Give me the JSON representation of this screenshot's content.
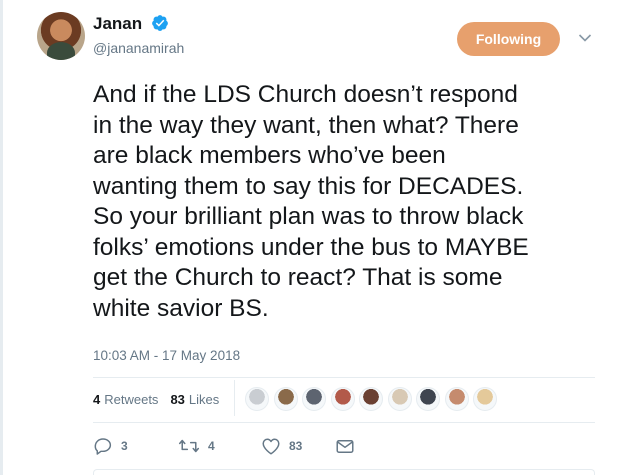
{
  "author": {
    "name": "Janan",
    "handle": "@jananamirah",
    "verified": true
  },
  "follow_button": {
    "label": "Following",
    "color": "#e7a06d"
  },
  "tweet": {
    "lines": [
      "And if the LDS Church doesn’t respond",
      "in the way they want, then what? There",
      "are black members who’ve been",
      "wanting them to say this for DECADES.",
      "So your brilliant plan was to throw black",
      "folks’ emotions under the bus to MAYBE",
      "get the Church to react? That is some",
      "white savior BS."
    ],
    "timestamp": "10:03 AM - 17 May 2018"
  },
  "stats": {
    "retweets_count": "4",
    "retweets_label": "Retweets",
    "likes_count": "83",
    "likes_label": "Likes"
  },
  "liker_avatars": [
    {
      "icon": "liker-avatar-1",
      "color": "#c9cdd2"
    },
    {
      "icon": "liker-avatar-2",
      "color": "#8a6a4a"
    },
    {
      "icon": "liker-avatar-3",
      "color": "#5d6470"
    },
    {
      "icon": "liker-avatar-4",
      "color": "#b25a4a"
    },
    {
      "icon": "liker-avatar-5",
      "color": "#6a4032"
    },
    {
      "icon": "liker-avatar-6",
      "color": "#d8c9b4"
    },
    {
      "icon": "liker-avatar-7",
      "color": "#3f4550"
    },
    {
      "icon": "liker-avatar-8",
      "color": "#c58b6e"
    },
    {
      "icon": "liker-avatar-9",
      "color": "#e4c99a"
    }
  ],
  "actions": {
    "reply_count": "3",
    "retweet_count": "4",
    "like_count": "83"
  },
  "colors": {
    "text": "#14171a",
    "secondary": "#657786",
    "divider": "#e6ecf0",
    "verified_blue": "#1da1f2"
  }
}
